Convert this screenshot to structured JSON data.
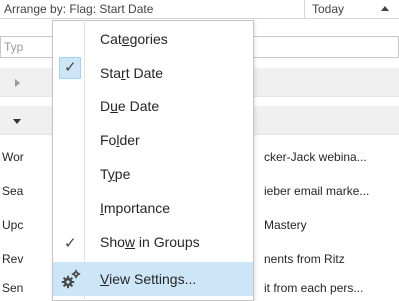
{
  "header": {
    "arrange_by": "Arrange by: Flag: Start Date",
    "today": "Today"
  },
  "search": {
    "placeholder": "Typ"
  },
  "list_items": [
    {
      "left": "Wor",
      "right": "cker-Jack webina..."
    },
    {
      "left": "Sea",
      "right": "ieber email marke..."
    },
    {
      "left": "Upc",
      "right": "Mastery"
    },
    {
      "left": "Rev",
      "right": "nents from Ritz"
    },
    {
      "left": "Sen",
      "right": "it from each pers..."
    }
  ],
  "menu": {
    "categories": {
      "pre": "Cat",
      "u": "e",
      "post": "gories"
    },
    "start_date": {
      "pre": "Sta",
      "u": "r",
      "post": "t Date"
    },
    "due_date": {
      "pre": "D",
      "u": "u",
      "post": "e Date"
    },
    "folder": {
      "pre": "Fo",
      "u": "l",
      "post": "der"
    },
    "type": {
      "pre": "T",
      "u": "y",
      "post": "pe"
    },
    "importance": {
      "pre": "",
      "u": "I",
      "post": "mportance"
    },
    "show_in_groups": {
      "pre": "Sho",
      "u": "w",
      "post": " in Groups"
    },
    "view_settings": {
      "pre": "",
      "u": "V",
      "post": "iew Settings..."
    },
    "checkmark": "✓",
    "checked_items": [
      "Start Date",
      "Show in Groups"
    ],
    "highlighted_item": "View Settings..."
  }
}
